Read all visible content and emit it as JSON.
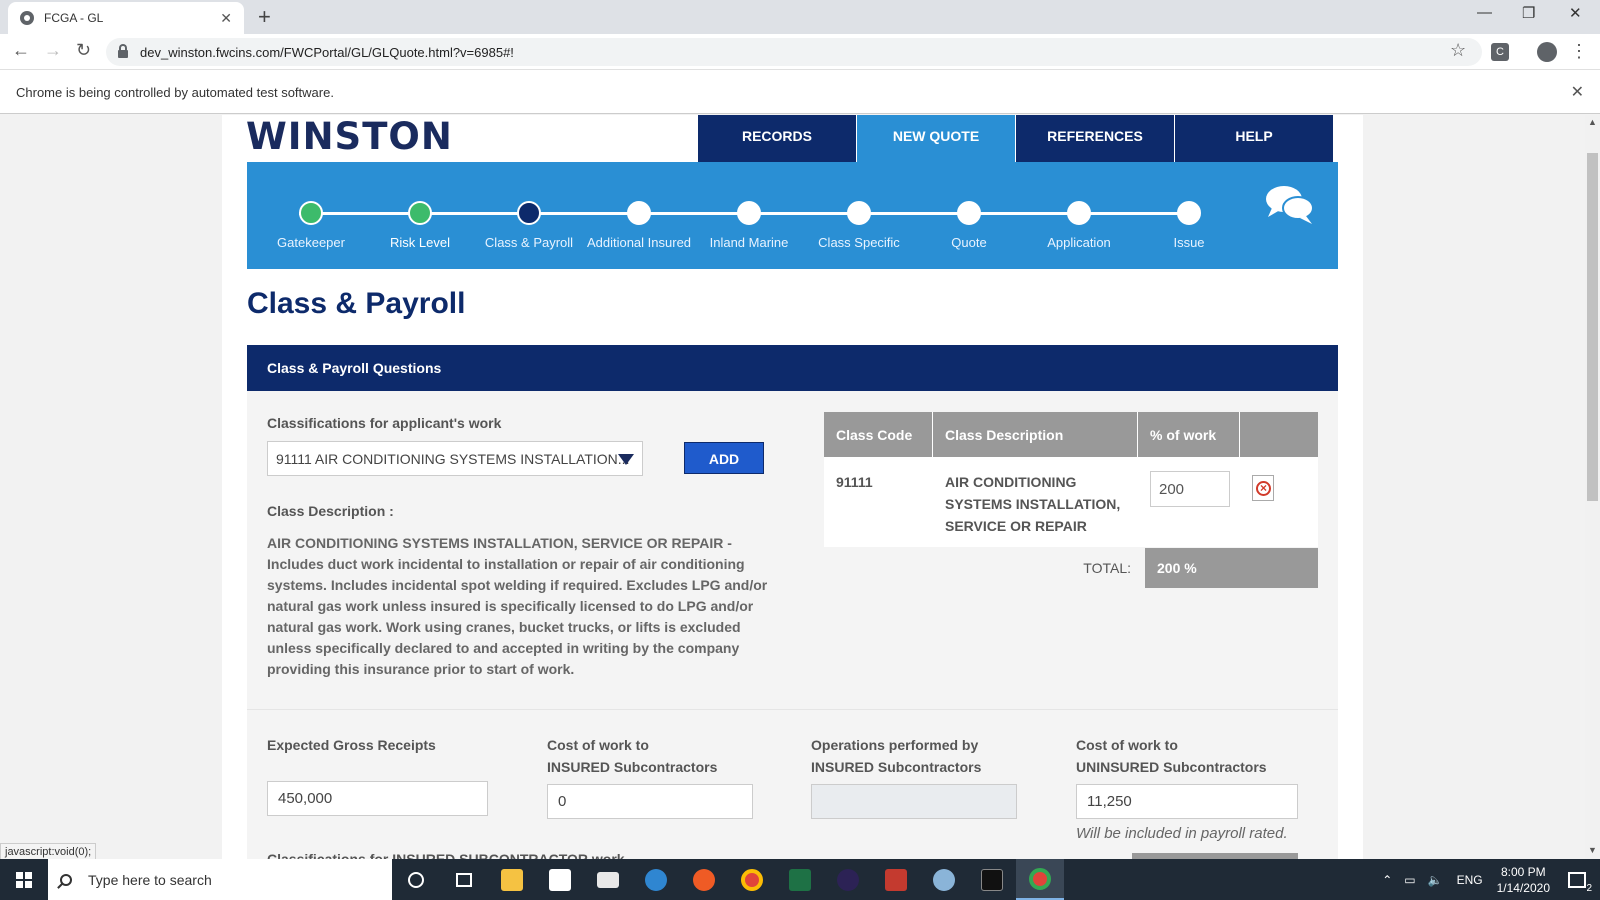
{
  "browser": {
    "tab_title": "FCGA - GL",
    "url": "dev_winston.fwcins.com/FWCPortal/GL/GLQuote.html?v=6985#!",
    "infobar": "Chrome is being controlled by automated test software.",
    "profile_ext": "C",
    "status_link": "javascript:void(0);"
  },
  "app": {
    "logo": "WINSTON",
    "nav": [
      "RECORDS",
      "NEW QUOTE",
      "REFERENCES",
      "HELP"
    ],
    "steps": [
      "Gatekeeper",
      "Risk Level",
      "Class & Payroll",
      "Additional Insured",
      "Inland Marine",
      "Class Specific",
      "Quote",
      "Application",
      "Issue"
    ],
    "page_title": "Class & Payroll",
    "section_title": "Class & Payroll Questions"
  },
  "form": {
    "classifications_label": "Classifications for applicant's work",
    "selected_class": "91111 AIR CONDITIONING SYSTEMS INSTALLATION...",
    "add_label": "ADD",
    "class_desc_label": "Class Description :",
    "class_desc_text": "AIR CONDITIONING SYSTEMS INSTALLATION, SERVICE OR REPAIR - Includes duct work incidental to installation or repair of air conditioning systems. Includes incidental spot welding if required. Excludes LPG and/or natural gas work unless insured is specifically licensed to do LPG and/or natural gas work. Work using cranes, bucket trucks, or lifts is excluded unless specifically declared to and accepted in writing by the company providing this insurance prior to start of work.",
    "table": {
      "headers": [
        "Class Code",
        "Class Description",
        "% of work"
      ],
      "rows": [
        {
          "code": "91111",
          "description": "AIR CONDITIONING SYSTEMS INSTALLATION, SERVICE OR REPAIR",
          "pct": "200"
        }
      ],
      "total_label": "TOTAL:",
      "total_value": "200 %"
    },
    "gross_receipts_label": "Expected Gross Receipts",
    "gross_receipts_value": "450,000",
    "insured_sub_cost_label_1": "Cost of work to",
    "insured_sub_cost_label_2": "INSURED Subcontractors",
    "insured_sub_cost_value": "0",
    "ops_label_1": "Operations performed by",
    "ops_label_2": "INSURED Subcontractors",
    "ops_value": "",
    "uninsured_label_1": "Cost of work to",
    "uninsured_label_2": "UNINSURED Subcontractors",
    "uninsured_value": "11,250",
    "uninsured_hint": "Will be included in payroll rated.",
    "next_label_cut": "Classifications for INSURED SUBCONTRACTOR work"
  },
  "taskbar": {
    "search_placeholder": "Type here to search",
    "time": "8:00 PM",
    "date": "1/14/2020",
    "lang": "ENG",
    "notif_count": "2"
  },
  "colors": {
    "navy": "#0d2a6b",
    "accent_blue": "#2a8fd4",
    "done_green": "#3dbb6b",
    "add_blue": "#1f5bcc"
  }
}
